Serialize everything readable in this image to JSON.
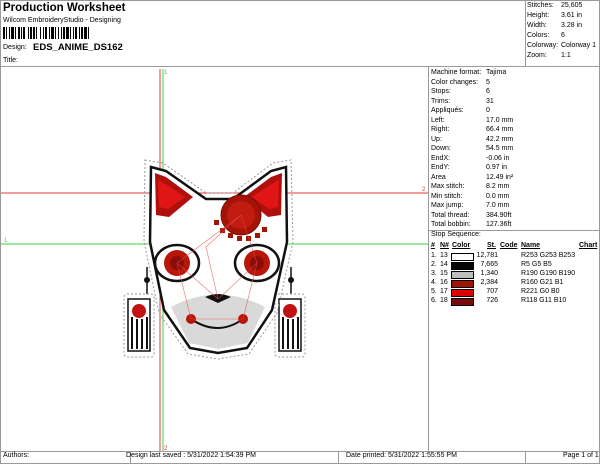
{
  "header": {
    "title": "Production Worksheet",
    "software": "Wilcom EmbroideryStudio - Designing",
    "design_label": "Design:",
    "design_name": "EDS_ANIME_DS162",
    "title_label": "Title:"
  },
  "summary": [
    {
      "key": "Stitches:",
      "value": "25,605"
    },
    {
      "key": "Height:",
      "value": "3.61 in"
    },
    {
      "key": "Width:",
      "value": "3.28 in"
    },
    {
      "key": "Colors:",
      "value": "6"
    },
    {
      "key": "Colorway:",
      "value": "Colorway 1"
    },
    {
      "key": "Zoom:",
      "value": "1:1"
    }
  ],
  "stats": [
    {
      "key": "Machine format:",
      "value": "Tajima"
    },
    {
      "key": "Color changes:",
      "value": "5"
    },
    {
      "key": "Stops:",
      "value": "6"
    },
    {
      "key": "Trims:",
      "value": "31"
    },
    {
      "key": "Appliqués:",
      "value": "0"
    },
    {
      "key": "Left:",
      "value": "17.0 mm"
    },
    {
      "key": "Right:",
      "value": "66.4 mm"
    },
    {
      "key": "Up:",
      "value": "42.2 mm"
    },
    {
      "key": "Down:",
      "value": "54.5 mm"
    },
    {
      "key": "EndX:",
      "value": "-0.06 in"
    },
    {
      "key": "EndY:",
      "value": "0.97 in"
    },
    {
      "key": "Area",
      "value": "12.49 in²"
    },
    {
      "key": "Max stitch:",
      "value": "8.2 mm"
    },
    {
      "key": "Min stitch:",
      "value": "0.0 mm"
    },
    {
      "key": "Max jump:",
      "value": "7.0 mm"
    },
    {
      "key": "Total thread:",
      "value": "384.90ft"
    },
    {
      "key": "Total bobbin:",
      "value": "127.36ft"
    }
  ],
  "stop_sequence": {
    "heading": "Stop Sequence:",
    "columns": {
      "num": "#",
      "needle": "N#",
      "color": "Color",
      "st": "St.",
      "code": "Code",
      "name": "Name",
      "chart": "Chart"
    },
    "rows": [
      {
        "num": "1.",
        "needle": "13",
        "swatch": "#FDFDFD",
        "st": "12,781",
        "name": "R253 G253 B253"
      },
      {
        "num": "2.",
        "needle": "14",
        "swatch": "#050505",
        "st": "7,665",
        "name": "R5 G5 B5"
      },
      {
        "num": "3.",
        "needle": "15",
        "swatch": "#BEBEBE",
        "st": "1,340",
        "name": "R190 G190 B190"
      },
      {
        "num": "4.",
        "needle": "16",
        "swatch": "#A01501",
        "st": "2,384",
        "name": "R160 G21 B1"
      },
      {
        "num": "5.",
        "needle": "17",
        "swatch": "#DD0000",
        "st": "707",
        "name": "R221 G0 B0"
      },
      {
        "num": "6.",
        "needle": "18",
        "swatch": "#760B0A",
        "st": "726",
        "name": "R118 G11 B10"
      }
    ]
  },
  "footer": {
    "authors": "Authors:",
    "last_saved": "Design last saved : 5/31/2022 1:54:39 PM",
    "printed": "Date printed: 5/31/2022 1:55:55 PM",
    "page": "Page 1 of 1"
  },
  "canvas": {
    "marker_top": "1",
    "marker_bottom": "2",
    "marker_left": "1",
    "marker_right": "2"
  }
}
